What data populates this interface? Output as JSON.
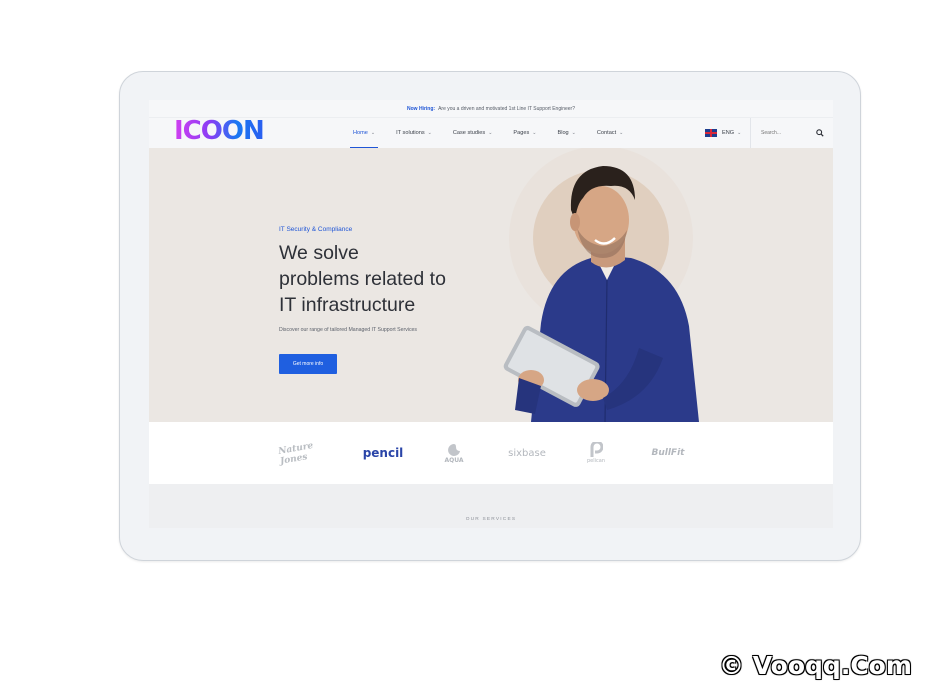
{
  "topbar": {
    "highlight": "Now Hiring:",
    "message": "Are you a driven and motivated 1st Line IT Support Engineer?"
  },
  "brand": {
    "logo_text": "ICOON"
  },
  "nav": {
    "items": [
      {
        "label": "Home",
        "active": true
      },
      {
        "label": "IT solutions",
        "active": false
      },
      {
        "label": "Case studies",
        "active": false
      },
      {
        "label": "Pages",
        "active": false
      },
      {
        "label": "Blog",
        "active": false
      },
      {
        "label": "Contact",
        "active": false
      }
    ],
    "language": "ENG",
    "search_placeholder": "Search..."
  },
  "hero": {
    "eyebrow": "IT Security & Compliance",
    "headline_line1": "We solve",
    "headline_line2": "problems related to",
    "headline_line3": "IT infrastructure",
    "subtext": "Discover our range of tailored Managed IT Support Services",
    "cta_label": "Get more info"
  },
  "partners": [
    {
      "name": "Nature Jones",
      "icon": "script-logo"
    },
    {
      "name": "pencil",
      "icon": "wordmark"
    },
    {
      "name": "AQUA",
      "icon": "wave-logo"
    },
    {
      "name": "sixbase",
      "icon": "wordmark"
    },
    {
      "name": "pelican",
      "icon": "p-logo"
    },
    {
      "name": "BullFit",
      "icon": "wordmark"
    }
  ],
  "services": {
    "label": "OUR SERVICES"
  },
  "watermark": "© Vooqq.Com",
  "colors": {
    "accent": "#1f55d6",
    "hero_bg": "#ebe7e3",
    "shirt": "#2b3a8a"
  }
}
